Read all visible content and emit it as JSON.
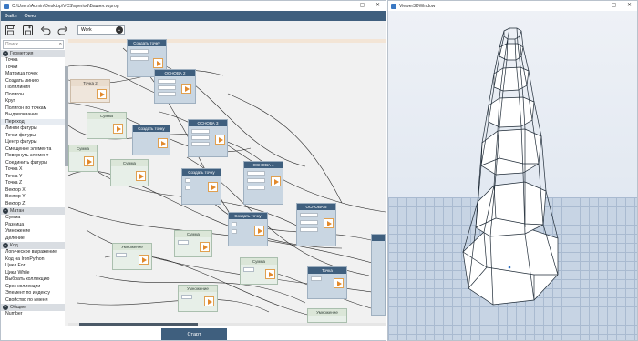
{
  "left_window": {
    "title": "C:\\Users\\Admin\\Desktop\\VCS\\xperiod\\Башня.vvprog",
    "menu": [
      "Файл",
      "Окно"
    ],
    "toolbar": {
      "mode_select": "Work"
    },
    "search_placeholder": "Поиск...",
    "categories": [
      {
        "name": "Геометрия",
        "items": [
          "Точка",
          "Точки",
          "Матрица точек",
          "Создать линию",
          "Полилиния",
          "Полигон",
          "Круг",
          "Полигон по точкам",
          "Выдавливание",
          "Переход",
          "Линии фигуры",
          "Точки фигуры",
          "Центр фигуры",
          "Смещение элемента",
          "Повернуть элемент",
          "Соединить фигуры",
          "Точка X",
          "Точка Y",
          "Точка Z",
          "Вектор X",
          "Вектор Y",
          "Вектор Z"
        ]
      },
      {
        "name": "Матан",
        "items": [
          "Сумма",
          "Разница",
          "Умножение",
          "Деление"
        ]
      },
      {
        "name": "Код",
        "items": [
          "Логическое выражение",
          "Код на IronPython",
          "Цикл For",
          "Цикл While",
          "Выбрать коллекцию",
          "Срез коллекции",
          "Элемент по индексу",
          "Свойство по имени"
        ]
      },
      {
        "name": "Общие",
        "items": [
          "Number"
        ]
      }
    ],
    "nodes": [
      {
        "title": "Создать точку",
        "style": "blue"
      },
      {
        "title": "ОСНОВА 2",
        "style": "blue"
      },
      {
        "title": "Точка 2",
        "style": "orange"
      },
      {
        "title": "Сумма",
        "style": "green"
      },
      {
        "title": "Создать точку",
        "style": "blue"
      },
      {
        "title": "ОСНОВА 3",
        "style": "blue"
      },
      {
        "title": "Сумма",
        "style": "green"
      },
      {
        "title": "Сумма",
        "style": "green"
      },
      {
        "title": "Создать точку",
        "style": "blue"
      },
      {
        "title": "ОСНОВА 4",
        "style": "blue"
      },
      {
        "title": "Создать точку",
        "style": "blue"
      },
      {
        "title": "ОСНОВА 5",
        "style": "blue"
      },
      {
        "title": "Умножение",
        "style": "green"
      },
      {
        "title": "Сумма",
        "style": "green"
      },
      {
        "title": "Сумма",
        "style": "green"
      },
      {
        "title": "Точка",
        "style": "blue"
      },
      {
        "title": "Умножение",
        "style": "green"
      },
      {
        "title": "Умножение",
        "style": "green"
      }
    ],
    "start_button": "Старт",
    "window_buttons": [
      "—",
      "▢",
      "✕"
    ]
  },
  "right_window": {
    "title": "Viewer3DWindow",
    "window_buttons": [
      "—",
      "▢",
      "✕"
    ]
  },
  "colors": {
    "header": "#3f5f7e",
    "accent_orange": "#e2892c",
    "node_blue": "#c9d6e2",
    "node_green": "#e7efe8",
    "floor": "#c7d4e4"
  }
}
